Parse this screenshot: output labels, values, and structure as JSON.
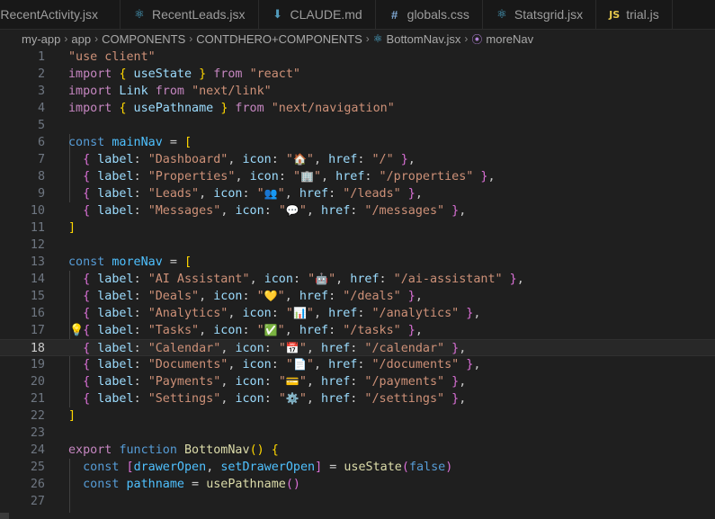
{
  "tabs": [
    {
      "label": "RecentActivity.jsx",
      "icon": "react-icon"
    },
    {
      "label": "RecentLeads.jsx",
      "icon": "react-icon"
    },
    {
      "label": "CLAUDE.md",
      "icon": "markdown-icon"
    },
    {
      "label": "globals.css",
      "icon": "css-icon"
    },
    {
      "label": "Statsgrid.jsx",
      "icon": "react-icon"
    },
    {
      "label": "trial.js",
      "icon": "js-icon",
      "icon_text": "JS"
    }
  ],
  "breadcrumb": {
    "items": [
      "my-app",
      "app",
      "COMPONENTS",
      "CONTDHERO+COMPONENTS"
    ],
    "file": "BottomNav.jsx",
    "symbol": "moreNav"
  },
  "editor": {
    "active_line": 18,
    "lines": [
      {
        "n": "1",
        "tokens": [
          [
            "s",
            "\"use client\""
          ]
        ]
      },
      {
        "n": "2",
        "tokens": [
          [
            "k",
            "import"
          ],
          [
            "p",
            " "
          ],
          [
            "y",
            "{"
          ],
          [
            "v",
            " useState "
          ],
          [
            "y",
            "}"
          ],
          [
            "k",
            " from"
          ],
          [
            "p",
            " "
          ],
          [
            "s",
            "\"react\""
          ]
        ]
      },
      {
        "n": "3",
        "tokens": [
          [
            "k",
            "import"
          ],
          [
            "v",
            " Link"
          ],
          [
            "k",
            " from"
          ],
          [
            "p",
            " "
          ],
          [
            "s",
            "\"next/link\""
          ]
        ]
      },
      {
        "n": "4",
        "tokens": [
          [
            "k",
            "import"
          ],
          [
            "p",
            " "
          ],
          [
            "y",
            "{"
          ],
          [
            "v",
            " usePathname "
          ],
          [
            "y",
            "}"
          ],
          [
            "k",
            " from"
          ],
          [
            "p",
            " "
          ],
          [
            "s",
            "\"next/navigation\""
          ]
        ]
      },
      {
        "n": "5",
        "tokens": []
      },
      {
        "n": "6",
        "tokens": [
          [
            "b",
            "const"
          ],
          [
            "p",
            " "
          ],
          [
            "c",
            "mainNav"
          ],
          [
            "p",
            " = "
          ],
          [
            "y",
            "["
          ]
        ]
      },
      {
        "n": "7",
        "tokens": [
          [
            "p",
            "  "
          ],
          [
            "br2",
            "{"
          ],
          [
            "v",
            " label"
          ],
          [
            "p",
            ": "
          ],
          [
            "s",
            "\"Dashboard\""
          ],
          [
            "p",
            ", "
          ],
          [
            "v",
            "icon"
          ],
          [
            "p",
            ": "
          ],
          [
            "s",
            "\""
          ],
          [
            "em",
            "🏠"
          ],
          [
            "s",
            "\""
          ],
          [
            "p",
            ", "
          ],
          [
            "v",
            "href"
          ],
          [
            "p",
            ": "
          ],
          [
            "s",
            "\"/\""
          ],
          [
            "p",
            " "
          ],
          [
            "br2",
            "}"
          ],
          [
            "p",
            ","
          ]
        ]
      },
      {
        "n": "8",
        "tokens": [
          [
            "p",
            "  "
          ],
          [
            "br2",
            "{"
          ],
          [
            "v",
            " label"
          ],
          [
            "p",
            ": "
          ],
          [
            "s",
            "\"Properties\""
          ],
          [
            "p",
            ", "
          ],
          [
            "v",
            "icon"
          ],
          [
            "p",
            ": "
          ],
          [
            "s",
            "\""
          ],
          [
            "em",
            "🏢"
          ],
          [
            "s",
            "\""
          ],
          [
            "p",
            ", "
          ],
          [
            "v",
            "href"
          ],
          [
            "p",
            ": "
          ],
          [
            "s",
            "\"/properties\""
          ],
          [
            "p",
            " "
          ],
          [
            "br2",
            "}"
          ],
          [
            "p",
            ","
          ]
        ]
      },
      {
        "n": "9",
        "tokens": [
          [
            "p",
            "  "
          ],
          [
            "br2",
            "{"
          ],
          [
            "v",
            " label"
          ],
          [
            "p",
            ": "
          ],
          [
            "s",
            "\"Leads\""
          ],
          [
            "p",
            ", "
          ],
          [
            "v",
            "icon"
          ],
          [
            "p",
            ": "
          ],
          [
            "s",
            "\""
          ],
          [
            "em",
            "👥"
          ],
          [
            "s",
            "\""
          ],
          [
            "p",
            ", "
          ],
          [
            "v",
            "href"
          ],
          [
            "p",
            ": "
          ],
          [
            "s",
            "\"/leads\""
          ],
          [
            "p",
            " "
          ],
          [
            "br2",
            "}"
          ],
          [
            "p",
            ","
          ]
        ]
      },
      {
        "n": "10",
        "tokens": [
          [
            "p",
            "  "
          ],
          [
            "br2",
            "{"
          ],
          [
            "v",
            " label"
          ],
          [
            "p",
            ": "
          ],
          [
            "s",
            "\"Messages\""
          ],
          [
            "p",
            ", "
          ],
          [
            "v",
            "icon"
          ],
          [
            "p",
            ": "
          ],
          [
            "s",
            "\""
          ],
          [
            "em",
            "💬"
          ],
          [
            "s",
            "\""
          ],
          [
            "p",
            ", "
          ],
          [
            "v",
            "href"
          ],
          [
            "p",
            ": "
          ],
          [
            "s",
            "\"/messages\""
          ],
          [
            "p",
            " "
          ],
          [
            "br2",
            "}"
          ],
          [
            "p",
            ","
          ]
        ]
      },
      {
        "n": "11",
        "tokens": [
          [
            "y",
            "]"
          ]
        ]
      },
      {
        "n": "12",
        "tokens": []
      },
      {
        "n": "13",
        "tokens": [
          [
            "b",
            "const"
          ],
          [
            "p",
            " "
          ],
          [
            "c",
            "moreNav"
          ],
          [
            "p",
            " = "
          ],
          [
            "y",
            "["
          ]
        ]
      },
      {
        "n": "14",
        "tokens": [
          [
            "p",
            "  "
          ],
          [
            "br2",
            "{"
          ],
          [
            "v",
            " label"
          ],
          [
            "p",
            ": "
          ],
          [
            "s",
            "\"AI Assistant\""
          ],
          [
            "p",
            ", "
          ],
          [
            "v",
            "icon"
          ],
          [
            "p",
            ": "
          ],
          [
            "s",
            "\""
          ],
          [
            "em",
            "🤖"
          ],
          [
            "s",
            "\""
          ],
          [
            "p",
            ", "
          ],
          [
            "v",
            "href"
          ],
          [
            "p",
            ": "
          ],
          [
            "s",
            "\"/ai-assistant\""
          ],
          [
            "p",
            " "
          ],
          [
            "br2",
            "}"
          ],
          [
            "p",
            ","
          ]
        ]
      },
      {
        "n": "15",
        "tokens": [
          [
            "p",
            "  "
          ],
          [
            "br2",
            "{"
          ],
          [
            "v",
            " label"
          ],
          [
            "p",
            ": "
          ],
          [
            "s",
            "\"Deals\""
          ],
          [
            "p",
            ", "
          ],
          [
            "v",
            "icon"
          ],
          [
            "p",
            ": "
          ],
          [
            "s",
            "\""
          ],
          [
            "em",
            "💛"
          ],
          [
            "s",
            "\""
          ],
          [
            "p",
            ", "
          ],
          [
            "v",
            "href"
          ],
          [
            "p",
            ": "
          ],
          [
            "s",
            "\"/deals\""
          ],
          [
            "p",
            " "
          ],
          [
            "br2",
            "}"
          ],
          [
            "p",
            ","
          ]
        ]
      },
      {
        "n": "16",
        "tokens": [
          [
            "p",
            "  "
          ],
          [
            "br2",
            "{"
          ],
          [
            "v",
            " label"
          ],
          [
            "p",
            ": "
          ],
          [
            "s",
            "\"Analytics\""
          ],
          [
            "p",
            ", "
          ],
          [
            "v",
            "icon"
          ],
          [
            "p",
            ": "
          ],
          [
            "s",
            "\""
          ],
          [
            "em",
            "📊"
          ],
          [
            "s",
            "\""
          ],
          [
            "p",
            ", "
          ],
          [
            "v",
            "href"
          ],
          [
            "p",
            ": "
          ],
          [
            "s",
            "\"/analytics\""
          ],
          [
            "p",
            " "
          ],
          [
            "br2",
            "}"
          ],
          [
            "p",
            ","
          ]
        ]
      },
      {
        "n": "17",
        "tokens": [
          [
            "p",
            "  "
          ],
          [
            "br2",
            "{"
          ],
          [
            "v",
            " label"
          ],
          [
            "p",
            ": "
          ],
          [
            "s",
            "\"Tasks\""
          ],
          [
            "p",
            ", "
          ],
          [
            "v",
            "icon"
          ],
          [
            "p",
            ": "
          ],
          [
            "s",
            "\""
          ],
          [
            "em",
            "✅"
          ],
          [
            "s",
            "\""
          ],
          [
            "p",
            ", "
          ],
          [
            "v",
            "href"
          ],
          [
            "p",
            ": "
          ],
          [
            "s",
            "\"/tasks\""
          ],
          [
            "p",
            " "
          ],
          [
            "br2",
            "}"
          ],
          [
            "p",
            ","
          ]
        ],
        "bulb": true
      },
      {
        "n": "18",
        "tokens": [
          [
            "p",
            "  "
          ],
          [
            "br2",
            "{"
          ],
          [
            "v",
            " label"
          ],
          [
            "p",
            ": "
          ],
          [
            "s",
            "\"Calendar\""
          ],
          [
            "p",
            ", "
          ],
          [
            "v",
            "icon"
          ],
          [
            "p",
            ": "
          ],
          [
            "s",
            "\""
          ],
          [
            "em",
            "📅"
          ],
          [
            "s",
            "\""
          ],
          [
            "p",
            ", "
          ],
          [
            "v",
            "href"
          ],
          [
            "p",
            ": "
          ],
          [
            "s",
            "\"/calendar\""
          ],
          [
            "p",
            " "
          ],
          [
            "br2",
            "}"
          ],
          [
            "p",
            ","
          ]
        ]
      },
      {
        "n": "19",
        "tokens": [
          [
            "p",
            "  "
          ],
          [
            "br2",
            "{"
          ],
          [
            "v",
            " label"
          ],
          [
            "p",
            ": "
          ],
          [
            "s",
            "\"Documents\""
          ],
          [
            "p",
            ", "
          ],
          [
            "v",
            "icon"
          ],
          [
            "p",
            ": "
          ],
          [
            "s",
            "\""
          ],
          [
            "em",
            "📄"
          ],
          [
            "s",
            "\""
          ],
          [
            "p",
            ", "
          ],
          [
            "v",
            "href"
          ],
          [
            "p",
            ": "
          ],
          [
            "s",
            "\"/documents\""
          ],
          [
            "p",
            " "
          ],
          [
            "br2",
            "}"
          ],
          [
            "p",
            ","
          ]
        ]
      },
      {
        "n": "20",
        "tokens": [
          [
            "p",
            "  "
          ],
          [
            "br2",
            "{"
          ],
          [
            "v",
            " label"
          ],
          [
            "p",
            ": "
          ],
          [
            "s",
            "\"Payments\""
          ],
          [
            "p",
            ", "
          ],
          [
            "v",
            "icon"
          ],
          [
            "p",
            ": "
          ],
          [
            "s",
            "\""
          ],
          [
            "em",
            "💳"
          ],
          [
            "s",
            "\""
          ],
          [
            "p",
            ", "
          ],
          [
            "v",
            "href"
          ],
          [
            "p",
            ": "
          ],
          [
            "s",
            "\"/payments\""
          ],
          [
            "p",
            " "
          ],
          [
            "br2",
            "}"
          ],
          [
            "p",
            ","
          ]
        ]
      },
      {
        "n": "21",
        "tokens": [
          [
            "p",
            "  "
          ],
          [
            "br2",
            "{"
          ],
          [
            "v",
            " label"
          ],
          [
            "p",
            ": "
          ],
          [
            "s",
            "\"Settings\""
          ],
          [
            "p",
            ", "
          ],
          [
            "v",
            "icon"
          ],
          [
            "p",
            ": "
          ],
          [
            "s",
            "\""
          ],
          [
            "em",
            "⚙️"
          ],
          [
            "s",
            "\""
          ],
          [
            "p",
            ", "
          ],
          [
            "v",
            "href"
          ],
          [
            "p",
            ": "
          ],
          [
            "s",
            "\"/settings\""
          ],
          [
            "p",
            " "
          ],
          [
            "br2",
            "}"
          ],
          [
            "p",
            ","
          ]
        ]
      },
      {
        "n": "22",
        "tokens": [
          [
            "y",
            "]"
          ]
        ]
      },
      {
        "n": "23",
        "tokens": []
      },
      {
        "n": "24",
        "tokens": [
          [
            "k",
            "export"
          ],
          [
            "p",
            " "
          ],
          [
            "b",
            "function"
          ],
          [
            "p",
            " "
          ],
          [
            "f",
            "BottomNav"
          ],
          [
            "y",
            "()"
          ],
          [
            "p",
            " "
          ],
          [
            "y",
            "{"
          ]
        ]
      },
      {
        "n": "25",
        "tokens": [
          [
            "p",
            "  "
          ],
          [
            "b",
            "const"
          ],
          [
            "p",
            " "
          ],
          [
            "br2",
            "["
          ],
          [
            "c",
            "drawerOpen"
          ],
          [
            "p",
            ", "
          ],
          [
            "c",
            "setDrawerOpen"
          ],
          [
            "br2",
            "]"
          ],
          [
            "p",
            " = "
          ],
          [
            "f",
            "useState"
          ],
          [
            "br2",
            "("
          ],
          [
            "b",
            "false"
          ],
          [
            "br2",
            ")"
          ]
        ]
      },
      {
        "n": "26",
        "tokens": [
          [
            "p",
            "  "
          ],
          [
            "b",
            "const"
          ],
          [
            "p",
            " "
          ],
          [
            "c",
            "pathname"
          ],
          [
            "p",
            " = "
          ],
          [
            "f",
            "usePathname"
          ],
          [
            "br2",
            "()"
          ]
        ]
      },
      {
        "n": "27",
        "tokens": []
      }
    ]
  }
}
